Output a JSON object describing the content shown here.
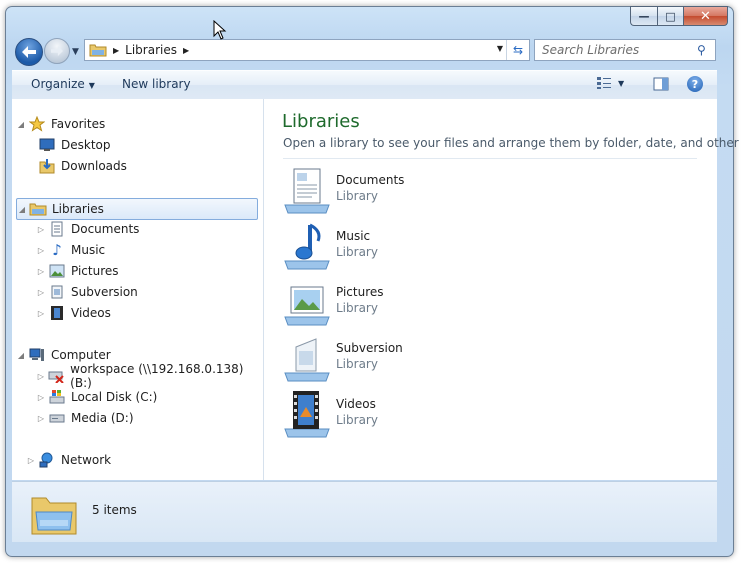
{
  "window": {
    "title": ""
  },
  "address_bar": {
    "crumbs": [
      "Libraries"
    ]
  },
  "search": {
    "placeholder": "Search Libraries"
  },
  "toolbar": {
    "organize": "Organize",
    "new_library": "New library"
  },
  "nav": {
    "favorites": {
      "label": "Favorites",
      "items": [
        "Desktop",
        "Downloads"
      ]
    },
    "libraries": {
      "label": "Libraries",
      "items": [
        "Documents",
        "Music",
        "Pictures",
        "Subversion",
        "Videos"
      ]
    },
    "computer": {
      "label": "Computer",
      "items": [
        "workspace (\\\\192.168.0.138) (B:)",
        "Local Disk (C:)",
        "Media (D:)"
      ]
    },
    "network": {
      "label": "Network"
    }
  },
  "main": {
    "title": "Libraries",
    "subtitle": "Open a library to see your files and arrange them by folder, date, and other ...",
    "items": [
      {
        "name": "Documents",
        "type": "Library",
        "icon": "documents-library-icon"
      },
      {
        "name": "Music",
        "type": "Library",
        "icon": "music-library-icon"
      },
      {
        "name": "Pictures",
        "type": "Library",
        "icon": "pictures-library-icon"
      },
      {
        "name": "Subversion",
        "type": "Library",
        "icon": "subversion-library-icon"
      },
      {
        "name": "Videos",
        "type": "Library",
        "icon": "videos-library-icon"
      }
    ]
  },
  "status": {
    "count": "5 items"
  },
  "colors": {
    "title_green": "#1e6a2c",
    "selection": "#dbe9f9",
    "frame": "#c2d8ef"
  }
}
